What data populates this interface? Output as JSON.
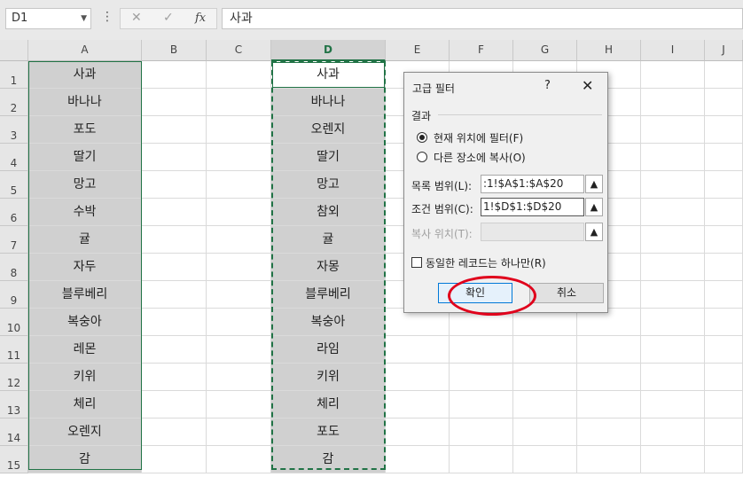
{
  "formula_bar": {
    "name_box": "D1",
    "cancel_glyph": "✕",
    "enter_glyph": "✓",
    "fx_label": "fx",
    "content": "사과"
  },
  "columns": [
    "A",
    "B",
    "C",
    "D",
    "E",
    "F",
    "G",
    "H",
    "I",
    "J"
  ],
  "selected_column": "D",
  "rows": [
    "1",
    "2",
    "3",
    "4",
    "5",
    "6",
    "7",
    "8",
    "9",
    "10",
    "11",
    "12",
    "13",
    "14",
    "15"
  ],
  "col_a": [
    "사과",
    "바나나",
    "포도",
    "딸기",
    "망고",
    "수박",
    "귤",
    "자두",
    "블루베리",
    "복숭아",
    "레몬",
    "키위",
    "체리",
    "오렌지",
    "감"
  ],
  "col_d": [
    "사과",
    "바나나",
    "오렌지",
    "딸기",
    "망고",
    "참외",
    "귤",
    "자몽",
    "블루베리",
    "복숭아",
    "라임",
    "키위",
    "체리",
    "포도",
    "감"
  ],
  "dialog": {
    "title": "고급 필터",
    "help": "?",
    "close": "✕",
    "section_result": "결과",
    "radio_filter_inplace": "현재 위치에 필터(F)",
    "radio_copy": "다른 장소에 복사(O)",
    "list_range_label": "목록 범위(L):",
    "list_range_value": ":1!$A$1:$A$20",
    "criteria_range_label": "조건 범위(C):",
    "criteria_range_value": "1!$D$1:$D$20",
    "copy_to_label": "복사 위치(T):",
    "copy_to_value": "",
    "unique_only_label": "동일한 레코드는 하나만(R)",
    "ok": "확인",
    "cancel": "취소"
  },
  "colors": {
    "accent_green": "#217346",
    "highlight_circle": "#e0001b",
    "ok_border": "#0078d7"
  }
}
